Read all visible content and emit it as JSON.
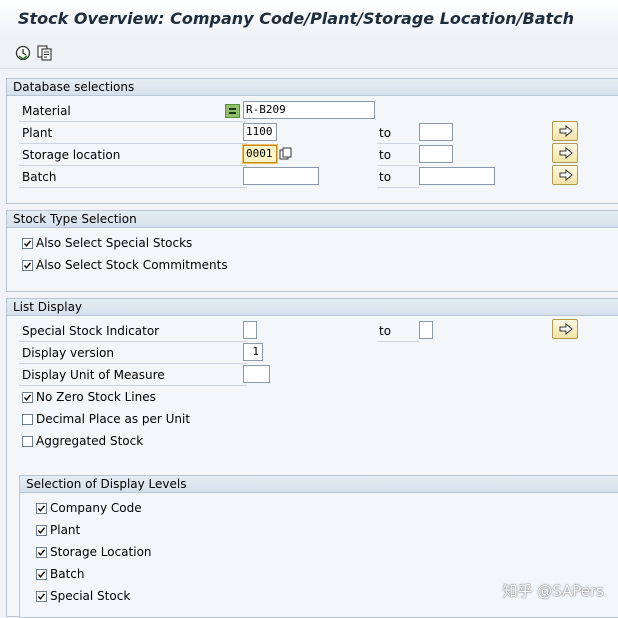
{
  "window": {
    "title": "Stock Overview: Company Code/Plant/Storage Location/Batch"
  },
  "toolbar": {
    "execute_icon": "execute-clock-icon",
    "variant_icon": "get-variant-icon"
  },
  "db_selections": {
    "heading": "Database selections",
    "material_label": "Material",
    "material_value": "R-B209",
    "plant_label": "Plant",
    "plant_value": "1100",
    "storage_label": "Storage location",
    "storage_value": "0001",
    "batch_label": "Batch",
    "batch_value": "",
    "to_label": "to"
  },
  "stock_type": {
    "heading": "Stock Type Selection",
    "special_stocks": "Also Select Special Stocks",
    "special_stocks_checked": true,
    "stock_commitments": "Also Select Stock Commitments",
    "stock_commitments_checked": true
  },
  "list_display": {
    "heading": "List Display",
    "special_indicator_label": "Special Stock Indicator",
    "special_indicator_value": "",
    "to_label": "to",
    "display_version_label": "Display version",
    "display_version_value": "1",
    "uom_label": "Display Unit of Measure",
    "uom_value": "",
    "no_zero": "No Zero Stock Lines",
    "no_zero_checked": true,
    "decimal_place": "Decimal Place as per Unit",
    "decimal_place_checked": false,
    "aggregated": "Aggregated Stock",
    "aggregated_checked": false
  },
  "display_levels": {
    "heading": "Selection of Display Levels",
    "company_code": "Company Code",
    "plant": "Plant",
    "storage_location": "Storage Location",
    "batch": "Batch",
    "special_stock": "Special Stock"
  },
  "watermark": "知乎 @SAPers"
}
